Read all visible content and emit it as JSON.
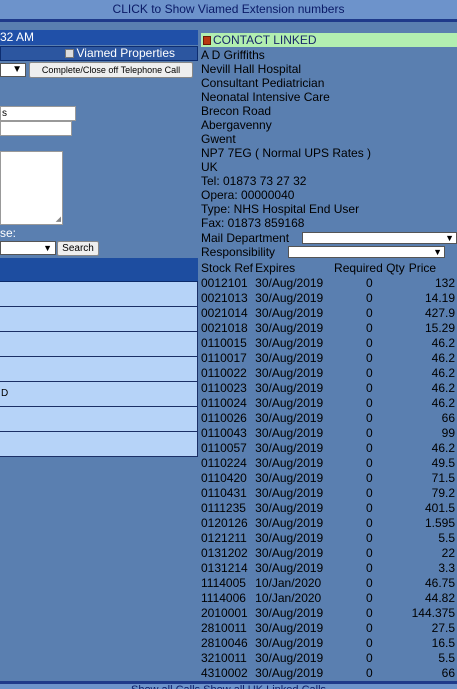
{
  "header": {
    "extension_link": "CLICK to Show Viamed Extension numbers"
  },
  "left": {
    "time_text": "32 AM",
    "viamed_properties_label": "Viamed Properties",
    "complete_button": "Complete/Close off Telephone Call",
    "select_arrow": "▼",
    "input1_value": "s",
    "select_label": "se:",
    "search_button": "Search",
    "results": [
      "",
      "",
      "",
      "",
      "D",
      "",
      ""
    ]
  },
  "contact": {
    "heading": "CONTACT LINKED",
    "lines": [
      "A D Griffiths",
      "Nevill Hall Hospital",
      "Consultant Pediatrician",
      "Neonatal Intensive Care",
      "Brecon Road",
      "Abergavenny",
      "Gwent",
      "NP7 7EG ( Normal UPS Rates )",
      "UK",
      "Tel: 01873 73 27 32",
      "Opera: 00000040",
      "Type: NHS Hospital End User",
      "Fax: 01873 859168"
    ],
    "mail_department_label": "Mail Department",
    "responsibility_label": "Responsibility",
    "select_arrow": "▼"
  },
  "stock_table": {
    "headers": [
      "Stock Ref",
      "Expires",
      "Required Qty",
      "Price"
    ],
    "rows": [
      [
        "0012101",
        "30/Aug/2019",
        "0",
        "132"
      ],
      [
        "0021013",
        "30/Aug/2019",
        "0",
        "14.19"
      ],
      [
        "0021014",
        "30/Aug/2019",
        "0",
        "427.9"
      ],
      [
        "0021018",
        "30/Aug/2019",
        "0",
        "15.29"
      ],
      [
        "0110015",
        "30/Aug/2019",
        "0",
        "46.2"
      ],
      [
        "0110017",
        "30/Aug/2019",
        "0",
        "46.2"
      ],
      [
        "0110022",
        "30/Aug/2019",
        "0",
        "46.2"
      ],
      [
        "0110023",
        "30/Aug/2019",
        "0",
        "46.2"
      ],
      [
        "0110024",
        "30/Aug/2019",
        "0",
        "46.2"
      ],
      [
        "0110026",
        "30/Aug/2019",
        "0",
        "66"
      ],
      [
        "0110043",
        "30/Aug/2019",
        "0",
        "99"
      ],
      [
        "0110057",
        "30/Aug/2019",
        "0",
        "46.2"
      ],
      [
        "0110224",
        "30/Aug/2019",
        "0",
        "49.5"
      ],
      [
        "0110420",
        "30/Aug/2019",
        "0",
        "71.5"
      ],
      [
        "0110431",
        "30/Aug/2019",
        "0",
        "79.2"
      ],
      [
        "0111235",
        "30/Aug/2019",
        "0",
        "401.5"
      ],
      [
        "0120126",
        "30/Aug/2019",
        "0",
        "1.595"
      ],
      [
        "0121211",
        "30/Aug/2019",
        "0",
        "5.5"
      ],
      [
        "0131202",
        "30/Aug/2019",
        "0",
        "22"
      ],
      [
        "0131214",
        "30/Aug/2019",
        "0",
        "3.3"
      ],
      [
        "1114005",
        "10/Jan/2020",
        "0",
        "46.75"
      ],
      [
        "1114006",
        "10/Jan/2020",
        "0",
        "44.82"
      ],
      [
        "2010001",
        "30/Aug/2019",
        "0",
        "144.375"
      ],
      [
        "2810011",
        "30/Aug/2019",
        "0",
        "27.5"
      ],
      [
        "2810046",
        "30/Aug/2019",
        "0",
        "16.5"
      ],
      [
        "3210011",
        "30/Aug/2019",
        "0",
        "5.5"
      ],
      [
        "4310002",
        "30/Aug/2019",
        "0",
        "66"
      ]
    ]
  },
  "footer": {
    "text": "Show all Calls   Show all UK Linked Calls"
  }
}
